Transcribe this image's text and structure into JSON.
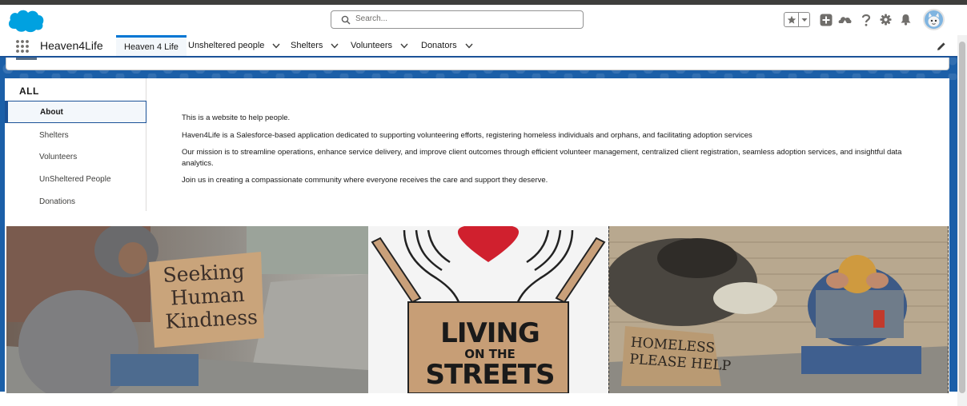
{
  "header": {
    "search_placeholder": "Search...",
    "icons": [
      "salesforce-cloud-logo",
      "favorites-star-icon",
      "favorites-dropdown-icon",
      "global-actions-plus-icon",
      "trailhead-icon",
      "help-question-icon",
      "setup-gear-icon",
      "notifications-bell-icon",
      "user-avatar"
    ]
  },
  "nav": {
    "app_name": "Heaven4Life",
    "tabs": [
      {
        "label": "Heaven 4 Life",
        "active": true,
        "has_menu": false
      },
      {
        "label": "Unsheltered people",
        "active": false,
        "has_menu": true
      },
      {
        "label": "Shelters",
        "active": false,
        "has_menu": true
      },
      {
        "label": "Volunteers",
        "active": false,
        "has_menu": true
      },
      {
        "label": "Donators",
        "active": false,
        "has_menu": true
      }
    ]
  },
  "sidebar": {
    "heading": "ALL",
    "items": [
      {
        "label": "About",
        "selected": true
      },
      {
        "label": "Shelters",
        "selected": false
      },
      {
        "label": "Volunteers",
        "selected": false
      },
      {
        "label": "UnSheltered People",
        "selected": false
      },
      {
        "label": "Donations",
        "selected": false
      }
    ]
  },
  "about": {
    "paragraphs": [
      "This is a website to help people.",
      "Haven4Life is a Salesforce-based application dedicated to supporting volunteering efforts, registering homeless individuals and orphans, and facilitating adoption services",
      "Our mission is to streamline operations, enhance service delivery, and improve client outcomes through efficient volunteer management, centralized client registration, seamless adoption services, and insightful data analytics.",
      "Join us in creating a compassionate community where everyone receives the care and support they deserve."
    ]
  },
  "images": {
    "img1_sign": [
      "Seeking",
      "Human",
      "Kindness"
    ],
    "img2_sign": [
      "LIVING",
      "ON THE",
      "STREETS"
    ],
    "img3_sign": [
      "HOMELESS",
      "PLEASE HELP"
    ]
  },
  "colors": {
    "brand_blue": "#1b5297",
    "accent": "#0176d3",
    "band": "#1b5fa8"
  }
}
